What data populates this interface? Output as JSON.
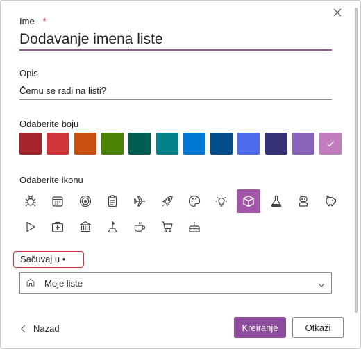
{
  "form": {
    "name_label": "Ime",
    "required_marker": "*",
    "name_value": "Dodavanje imena liste",
    "description_label": "Opis",
    "description_placeholder": "Čemu se radi na listi?",
    "color_label": "Odaberite boju",
    "icon_label": "Odaberite ikonu",
    "save_label": "Sačuvaj u •",
    "location_value": "Moje liste"
  },
  "colors": [
    "#a4262c",
    "#d13438",
    "#ca5010",
    "#498205",
    "#005e50",
    "#038387",
    "#0078d4",
    "#004e8c",
    "#4f6bed",
    "#373277",
    "#8764b8",
    "#c27dbe"
  ],
  "selected_color_index": 11,
  "icons": [
    "bug-icon",
    "calendar-icon",
    "target-icon",
    "clipboard-icon",
    "airplane-icon",
    "rocket-icon",
    "palette-icon",
    "lightbulb-icon",
    "cube-icon",
    "flask-icon",
    "robot-icon",
    "piggy-bank-icon",
    "play-icon",
    "first-aid-kit-icon",
    "bank-icon",
    "map-pin-icon",
    "coffee-cup-icon",
    "shopping-cart-icon",
    "cake-icon"
  ],
  "selected_icon_index": 8,
  "footer": {
    "back_label": "Nazad",
    "create_label": "Kreiranje",
    "cancel_label": "Otkaži"
  }
}
